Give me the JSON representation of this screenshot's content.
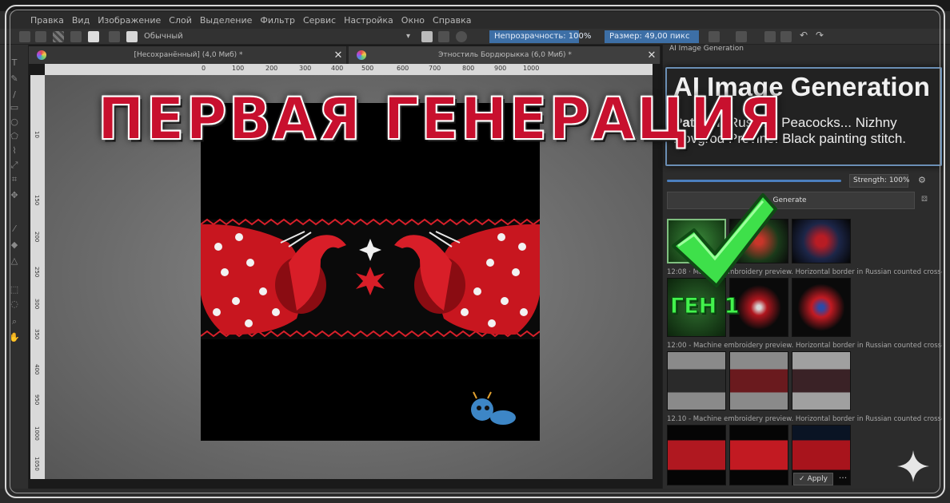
{
  "menu": [
    "Правка",
    "Вид",
    "Изображение",
    "Слой",
    "Выделение",
    "Фильтр",
    "Сервис",
    "Настройка",
    "Окно",
    "Справка"
  ],
  "toolbar": {
    "blend_mode": "Обычный",
    "opacity": "Непрозрачность: 100%",
    "size": "Размер: 49,00 пикс"
  },
  "tabs": [
    {
      "title": "[Несохранённый]  (4,0 Миб) *"
    },
    {
      "title": "Этностиль Бордюрыкка (6,0 Миб) *"
    }
  ],
  "ruler": {
    "h": [
      "0",
      "100",
      "200",
      "300",
      "400",
      "500",
      "600",
      "700",
      "800",
      "900",
      "1000"
    ],
    "v": [
      "10",
      "150",
      "200",
      "250",
      "300",
      "350",
      "400",
      "950",
      "1000",
      "1050"
    ]
  },
  "overlay": {
    "title": "ПЕРВАЯ ГЕНЕРАЦИЯ",
    "badge": "ГЕН 1"
  },
  "docker": {
    "header": "AI Image Generation",
    "callout_title": "AI Image Generation",
    "pattern_label": "Pattern:",
    "pattern_text": "Russian Peacocks... Nizhny Novgrod Provine. Black painting stitch.",
    "strength": "Strength: 100%",
    "generate": "Generate",
    "captions": [
      "12:08 · Machine embroidery preview. Horizontal border in Russian counted cross-st",
      "12:00 - Machine embroidery preview. Horizontal border in Russian counted cross-st",
      "12.10 - Machine embroidery preview. Horizontal border in Russian counted cross-st"
    ],
    "apply": "Apply",
    "more": "···"
  },
  "colors": {
    "accent": "#3d6fa6",
    "title_red": "#c8102e",
    "check_green": "#43f24d"
  }
}
